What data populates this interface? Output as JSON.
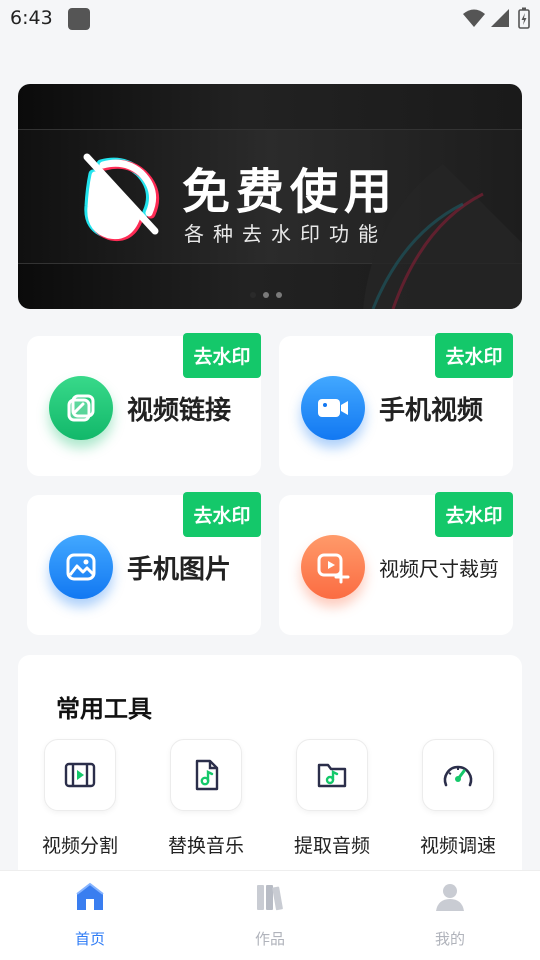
{
  "status_bar": {
    "time": "6:43"
  },
  "banner": {
    "title": "免费使用",
    "subtitle": "各种去水印功能",
    "dots": 3
  },
  "cards": [
    {
      "badge": "去水印",
      "label": "视频链接",
      "icon": "link-icon",
      "color": "#12b86a"
    },
    {
      "badge": "去水印",
      "label": "手机视频",
      "icon": "video-camera-icon",
      "color": "#1278f2"
    },
    {
      "badge": "去水印",
      "label": "手机图片",
      "icon": "image-icon",
      "color": "#1278f2"
    },
    {
      "badge": "去水印",
      "label": "视频尺寸裁剪",
      "icon": "video-crop-icon",
      "color": "#fb6c42"
    }
  ],
  "tools": {
    "title": "常用工具",
    "items": [
      {
        "label": "视频分割",
        "icon": "video-split-icon"
      },
      {
        "label": "替换音乐",
        "icon": "music-file-icon"
      },
      {
        "label": "提取音频",
        "icon": "music-folder-icon"
      },
      {
        "label": "视频调速",
        "icon": "speedometer-icon"
      }
    ]
  },
  "nav": {
    "items": [
      {
        "label": "首页",
        "icon": "home-icon",
        "active": true
      },
      {
        "label": "作品",
        "icon": "books-icon",
        "active": false
      },
      {
        "label": "我的",
        "icon": "user-icon",
        "active": false
      }
    ],
    "active_color": "#2f7cf6",
    "inactive_color": "#b0b3bb"
  },
  "colors": {
    "badge": "#14c86a",
    "background": "#f5f6f8"
  }
}
